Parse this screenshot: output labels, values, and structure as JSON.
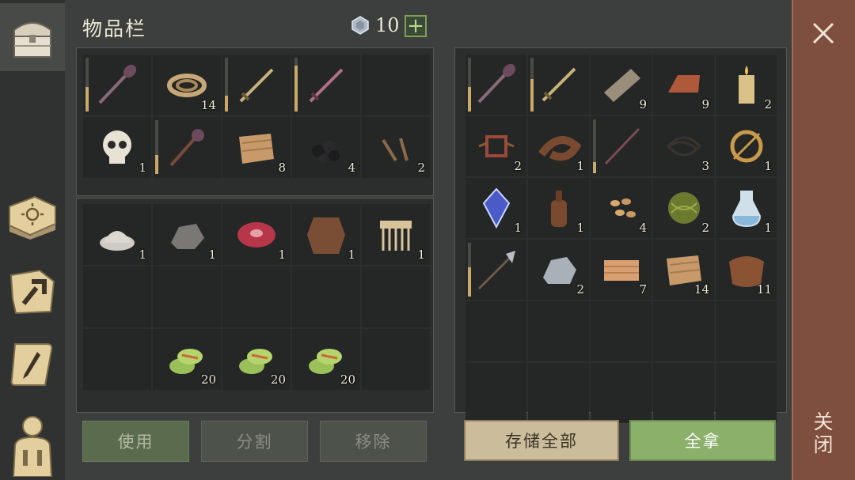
{
  "header": {
    "title": "物品栏",
    "currency_count": "10",
    "add_label": "+"
  },
  "sidebar": {
    "tabs": [
      {
        "icon": "chest-icon",
        "active": true
      },
      {
        "icon": "sun-book-icon",
        "active": false
      },
      {
        "icon": "crafting-hammer-icon",
        "active": false
      },
      {
        "icon": "quest-scroll-icon",
        "active": false
      },
      {
        "icon": "character-icon",
        "active": false
      }
    ]
  },
  "inventory": {
    "equipment_slots": [
      {
        "icon": "mace-icon",
        "qty": "",
        "durability": 0.45
      },
      {
        "icon": "rope-icon",
        "qty": "14"
      },
      {
        "icon": "sword-icon",
        "qty": "",
        "durability": 0.3
      },
      {
        "icon": "red-sword-icon",
        "qty": "",
        "durability": 0.85
      },
      {
        "icon": "",
        "qty": ""
      },
      {
        "icon": "skull-icon",
        "qty": "1"
      },
      {
        "icon": "morningstar-icon",
        "qty": "",
        "durability": 0.35
      },
      {
        "icon": "fabric-icon",
        "qty": "8"
      },
      {
        "icon": "coal-icon",
        "qty": "4"
      },
      {
        "icon": "nails-icon",
        "qty": "2"
      }
    ],
    "bag_slots": [
      {
        "icon": "flour-icon",
        "qty": "1"
      },
      {
        "icon": "stone-icon",
        "qty": "1"
      },
      {
        "icon": "raw-meat-icon",
        "qty": "1"
      },
      {
        "icon": "leather-hide-icon",
        "qty": "1"
      },
      {
        "icon": "comb-icon",
        "qty": "1"
      },
      {
        "icon": "",
        "qty": ""
      },
      {
        "icon": "",
        "qty": ""
      },
      {
        "icon": "",
        "qty": ""
      },
      {
        "icon": "",
        "qty": ""
      },
      {
        "icon": "",
        "qty": ""
      },
      {
        "icon": "",
        "qty": ""
      },
      {
        "icon": "green-herb-icon",
        "qty": "20"
      },
      {
        "icon": "green-herb-icon",
        "qty": "20"
      },
      {
        "icon": "green-herb-icon",
        "qty": "20"
      },
      {
        "icon": "",
        "qty": ""
      }
    ],
    "buttons": {
      "use": "使用",
      "split": "分割",
      "remove": "移除"
    }
  },
  "container": {
    "slots": [
      {
        "icon": "mace-icon",
        "qty": "",
        "durability": 0.45
      },
      {
        "icon": "sword-icon",
        "qty": "",
        "durability": 0.6
      },
      {
        "icon": "plank-icon",
        "qty": "9"
      },
      {
        "icon": "copper-ingot-icon",
        "qty": "9"
      },
      {
        "icon": "candle-icon",
        "qty": "2"
      },
      {
        "icon": "scrap-parts-icon",
        "qty": "2"
      },
      {
        "icon": "leather-strap-icon",
        "qty": "1"
      },
      {
        "icon": "staff-icon",
        "qty": "",
        "durability": 0.2
      },
      {
        "icon": "wire-icon",
        "qty": "3"
      },
      {
        "icon": "brooch-icon",
        "qty": "1"
      },
      {
        "icon": "crystal-icon",
        "qty": "1"
      },
      {
        "icon": "bottle-icon",
        "qty": "1"
      },
      {
        "icon": "seeds-icon",
        "qty": "4"
      },
      {
        "icon": "fiber-ball-icon",
        "qty": "2"
      },
      {
        "icon": "potion-icon",
        "qty": "1"
      },
      {
        "icon": "halberd-icon",
        "qty": "",
        "durability": 0.55
      },
      {
        "icon": "ore-icon",
        "qty": "2"
      },
      {
        "icon": "cloth-roll-icon",
        "qty": "7"
      },
      {
        "icon": "fabric-icon",
        "qty": "14"
      },
      {
        "icon": "leather-icon",
        "qty": "11"
      },
      {
        "icon": "",
        "qty": ""
      },
      {
        "icon": "",
        "qty": ""
      },
      {
        "icon": "",
        "qty": ""
      },
      {
        "icon": "",
        "qty": ""
      },
      {
        "icon": "",
        "qty": ""
      },
      {
        "icon": "",
        "qty": ""
      },
      {
        "icon": "",
        "qty": ""
      },
      {
        "icon": "",
        "qty": ""
      },
      {
        "icon": "",
        "qty": ""
      },
      {
        "icon": "",
        "qty": ""
      }
    ],
    "buttons": {
      "store_all": "存储全部",
      "take_all": "全拿"
    }
  },
  "close": {
    "label": "关闭"
  },
  "colors": {
    "accent_green": "#8bb06a",
    "close_panel": "#7e4e3f",
    "durability": "#c9a86a"
  }
}
